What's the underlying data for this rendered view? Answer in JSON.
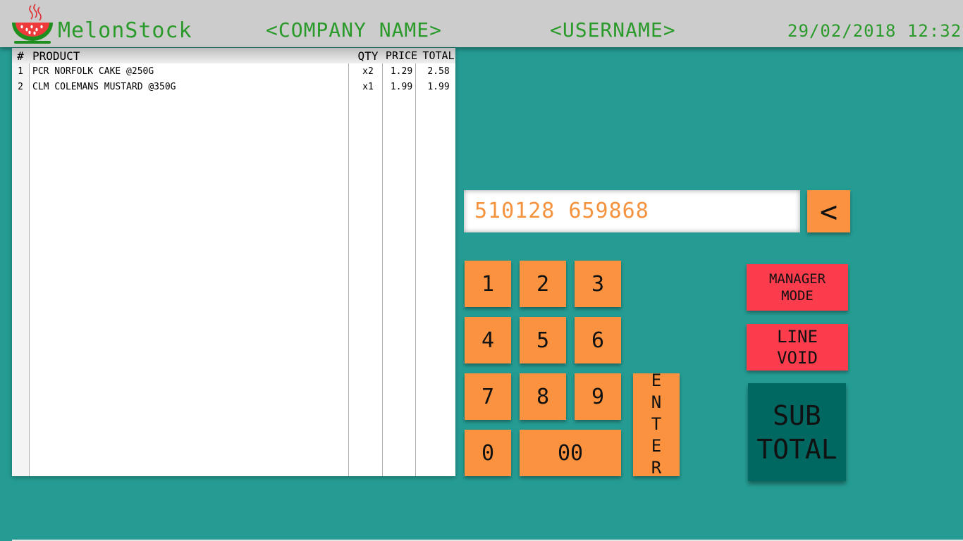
{
  "header": {
    "brand": "MelonStock",
    "company": "<COMPANY NAME>",
    "user": "<USERNAME>",
    "datetime": "29/02/2018 12:32"
  },
  "receipt": {
    "columns": [
      "#",
      "PRODUCT",
      "QTY",
      "PRICE",
      "TOTAL"
    ],
    "rows": [
      {
        "num": "1",
        "product": "PCR NORFOLK CAKE @250G",
        "qty": "x2",
        "price": "1.29",
        "total": "2.58"
      },
      {
        "num": "2",
        "product": "CLM COLEMANS MUSTARD @350G",
        "qty": "x1",
        "price": "1.99",
        "total": "1.99"
      }
    ]
  },
  "input": {
    "value": "510128 659868",
    "backspace_label": "<"
  },
  "keypad": {
    "k1": "1",
    "k2": "2",
    "k3": "3",
    "k4": "4",
    "k5": "5",
    "k6": "6",
    "k7": "7",
    "k8": "8",
    "k9": "9",
    "k0": "0",
    "k00": "00",
    "enter": "ENTER"
  },
  "actions": {
    "manager_mode": "MANAGER\nMODE",
    "line_void": "LINE\nVOID",
    "subtotal": "SUB\nTOTAL"
  },
  "colors": {
    "background": "#259c93",
    "header": "#cccccc",
    "header_text": "#2a9a2a",
    "key": "#fb923f",
    "danger": "#fb3c4c",
    "subtotal": "#006861"
  },
  "icons": {
    "logo": "watermelon-bowl-icon"
  }
}
